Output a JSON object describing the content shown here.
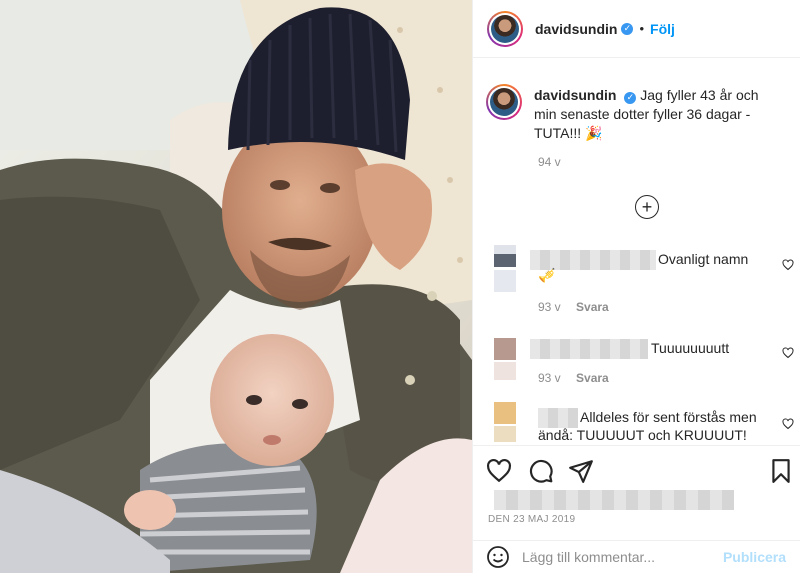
{
  "post": {
    "username": "davidsundin",
    "follow_label": "Följ",
    "dot": "•",
    "caption_text": "Jag fyller 43 år och min senaste dotter fyller 36 dagar - TUTA!!!",
    "caption_emoji": "🎉",
    "caption_time": "94 v",
    "date": "DEN 23 MAJ 2019"
  },
  "comments": [
    {
      "text": "Ovanligt namn",
      "emoji": "🎺",
      "time": "93 v",
      "reply": "Svara",
      "avatar_colors": [
        "#e0e3ea",
        "#5b6470",
        "#e5e8ee"
      ]
    },
    {
      "text": "Tuuuuuuuutt",
      "time": "93 v",
      "reply": "Svara",
      "avatar_colors": [
        "#dcc7c2",
        "#b8998f",
        "#efe3e0"
      ]
    },
    {
      "text_line1": "Alldeles för sent förstås men",
      "text_line2": "ändå: TUUUUUT och KRUUUUT!",
      "avatar_colors": [
        "#f2d6a6",
        "#e9c07f",
        "#ecdcc0"
      ]
    }
  ],
  "add_comment": {
    "placeholder": "Lägg till kommentar...",
    "post_label": "Publicera"
  },
  "icons": [
    "heart-icon",
    "comment-icon",
    "share-icon",
    "bookmark-icon",
    "emoji-icon",
    "add-icon",
    "verified-icon"
  ],
  "colors": {
    "link": "#0095f6",
    "muted": "#8e8e8e",
    "post_disabled": "#b2dffc",
    "verified": "#3897f0"
  }
}
